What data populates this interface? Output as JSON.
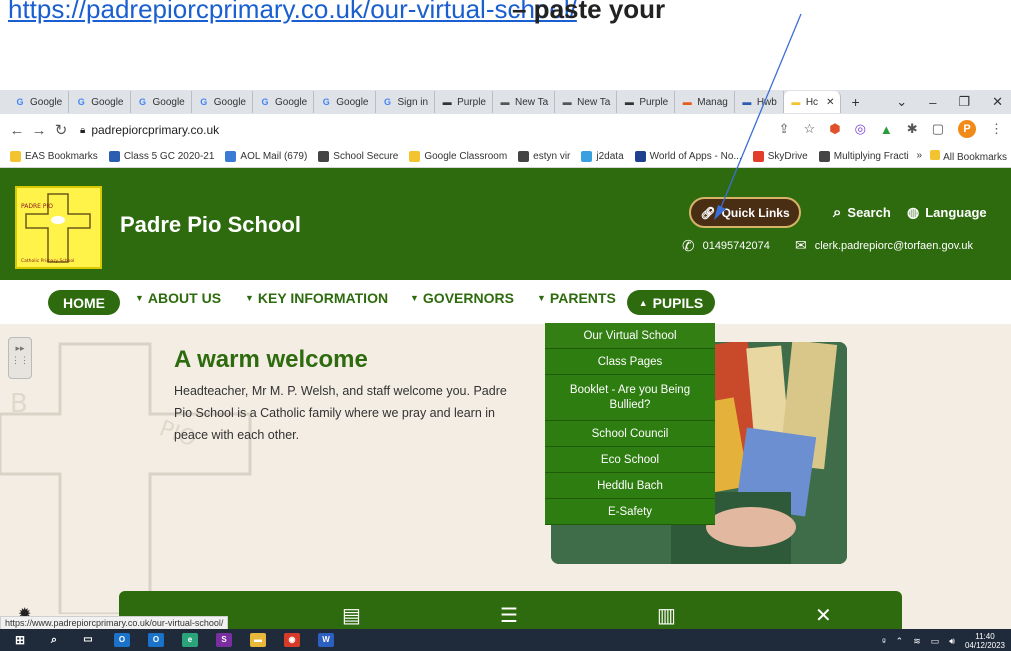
{
  "doc": {
    "link_text": "https://padrepiorcprimary.co.uk/our-virtual-school/",
    "bold_text": "– paste your"
  },
  "browser": {
    "tabs": [
      {
        "label": "Google"
      },
      {
        "label": "Google"
      },
      {
        "label": "Google"
      },
      {
        "label": "Google"
      },
      {
        "label": "Google"
      },
      {
        "label": "Google"
      },
      {
        "label": "Sign in"
      },
      {
        "label": "Purple"
      },
      {
        "label": "New Ta"
      },
      {
        "label": "New Ta"
      },
      {
        "label": "Purple"
      },
      {
        "label": "Manag"
      },
      {
        "label": "Hwb"
      },
      {
        "label": "Hc"
      }
    ],
    "new_tab": "+",
    "url": "padrepiorcprimary.co.uk",
    "profile_initial": "P",
    "bookmarks": [
      {
        "label": "EAS Bookmarks",
        "color": "#f4c430"
      },
      {
        "label": "Class 5 GC 2020-21",
        "color": "#2a5db0"
      },
      {
        "label": "AOL Mail (679)",
        "color": "#3a7bd5"
      },
      {
        "label": "School Secure",
        "color": "#444444"
      },
      {
        "label": "Google Classroom",
        "color": "#f4c430"
      },
      {
        "label": "estyn vir",
        "color": "#444444"
      },
      {
        "label": "j2data",
        "color": "#3aa0e0"
      },
      {
        "label": "World of Apps - No...",
        "color": "#1f3f8f"
      },
      {
        "label": "SkyDrive",
        "color": "#e23c2a"
      },
      {
        "label": "Multiplying Fractio...",
        "color": "#444444"
      }
    ],
    "bookmarks_more": "»",
    "all_bookmarks": "All Bookmarks"
  },
  "site": {
    "name": "Padre Pio School",
    "logo_text_top": "PADRE PIO",
    "logo_text_bottom": "Catholic Primary School",
    "quick_links": "Quick Links",
    "search": "Search",
    "language": "Language",
    "phone": "01495742074",
    "email": "clerk.padrepiorc@torfaen.gov.uk",
    "nav": {
      "home": "HOME",
      "about": "ABOUT US",
      "key_info": "KEY INFORMATION",
      "governors": "GOVERNORS",
      "parents": "PARENTS",
      "pupils": "PUPILS"
    },
    "dropdown": [
      "Our Virtual School",
      "Class Pages",
      "Booklet - Are you Being Bullied?",
      "School Council",
      "Eco School",
      "Heddlu Bach",
      "E-Safety"
    ],
    "welcome_title": "A warm welcome",
    "welcome_text": "Headteacher, Mr M. P. Welsh, and staff welcome you. Padre Pio School is a Catholic family where we pray and learn in peace with each other."
  },
  "status_url": "https://www.padrepiorcprimary.co.uk/our-virtual-school/",
  "taskbar": {
    "time": "11:40",
    "date": "04/12/2023"
  },
  "colors": {
    "brand_green": "#2e6b0e",
    "dropdown_green": "#2e7d11",
    "page_bg": "#f3ede4",
    "quick_links_bg": "#4a2e14"
  }
}
